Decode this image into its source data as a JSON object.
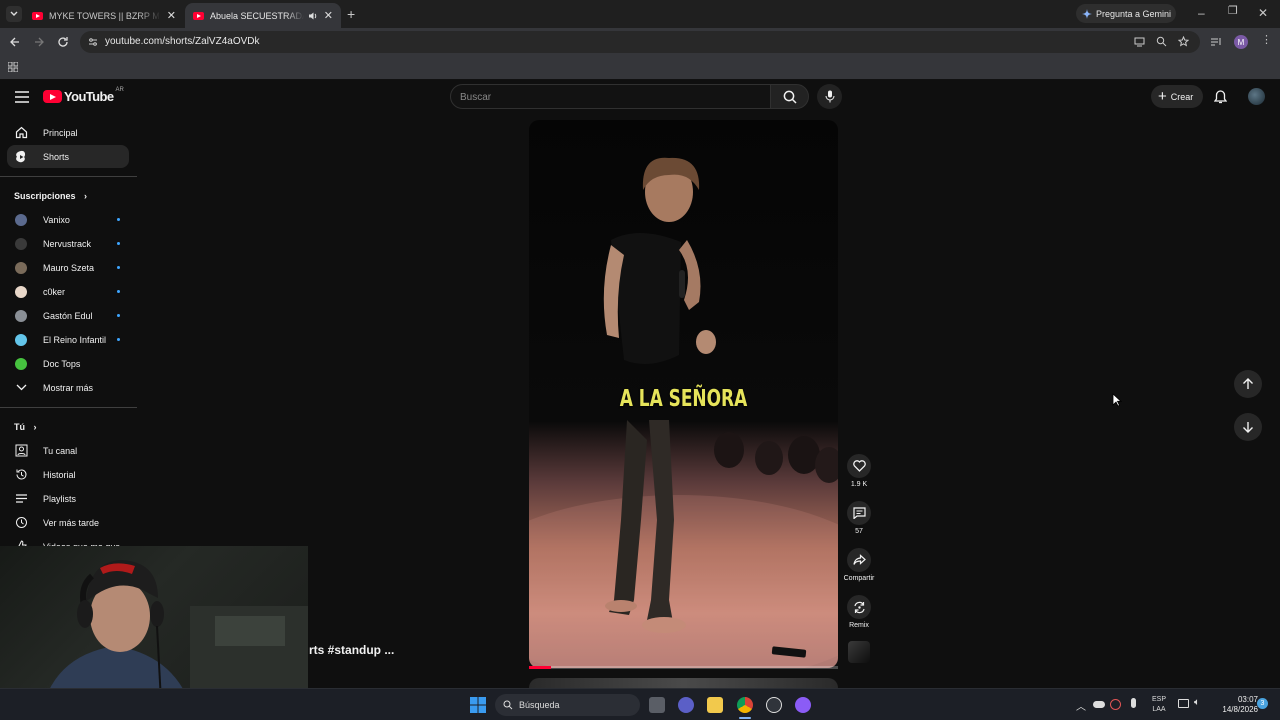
{
  "browser": {
    "tabs": [
      {
        "title": "MYKE TOWERS || BZRP Music Se",
        "active": false
      },
      {
        "title": "Abuela SECUESTRADA #Sh",
        "active": true
      }
    ],
    "gemini_label": "Pregunta a Gemini",
    "url": "youtube.com/shorts/ZalVZ4aOVDk",
    "profile_initial": "M"
  },
  "youtube": {
    "logo_text": "YouTube",
    "region": "AR",
    "search_placeholder": "Buscar",
    "create_label": "Crear",
    "nav": [
      {
        "label": "Principal",
        "icon": "home-icon"
      },
      {
        "label": "Shorts",
        "icon": "shorts-icon"
      }
    ],
    "subscriptions_title": "Suscripciones",
    "subscriptions": [
      {
        "label": "Vanixo",
        "color": "#5b6a8e"
      },
      {
        "label": "Nervustrack",
        "color": "#3a3a3a"
      },
      {
        "label": "Mauro Szeta",
        "color": "#7a6b5a"
      },
      {
        "label": "c0ker",
        "color": "#e8d7c9"
      },
      {
        "label": "Gastón Edul",
        "color": "#8a8f96"
      },
      {
        "label": "El Reino Infantil",
        "color": "#63c5ea"
      },
      {
        "label": "Doc Tops",
        "color": "#46c23f"
      }
    ],
    "show_more": "Mostrar más",
    "you_title": "Tú",
    "you_items": [
      {
        "label": "Tu canal",
        "icon": "channel-icon"
      },
      {
        "label": "Historial",
        "icon": "history-icon"
      },
      {
        "label": "Playlists",
        "icon": "playlists-icon"
      },
      {
        "label": "Ver más tarde",
        "icon": "watch-later-icon"
      },
      {
        "label": "Videos que me gus",
        "icon": "liked-icon"
      }
    ],
    "short": {
      "caption": "A LA SEÑORA",
      "title_fragment": "rts #standup ...",
      "likes": "1.9 K",
      "comments": "57",
      "share_label": "Compartir",
      "remix_label": "Remix",
      "progress": 0.07
    }
  },
  "taskbar": {
    "search_label": "Búsqueda",
    "lang_top": "ESP",
    "lang_bottom": "LAA",
    "time": "03:07",
    "date": "14/8/2026",
    "badge": "3"
  },
  "colors": {
    "accent_red": "#ff0033",
    "caption_yellow": "#e6e45a",
    "link_blue": "#3ea6ff"
  }
}
